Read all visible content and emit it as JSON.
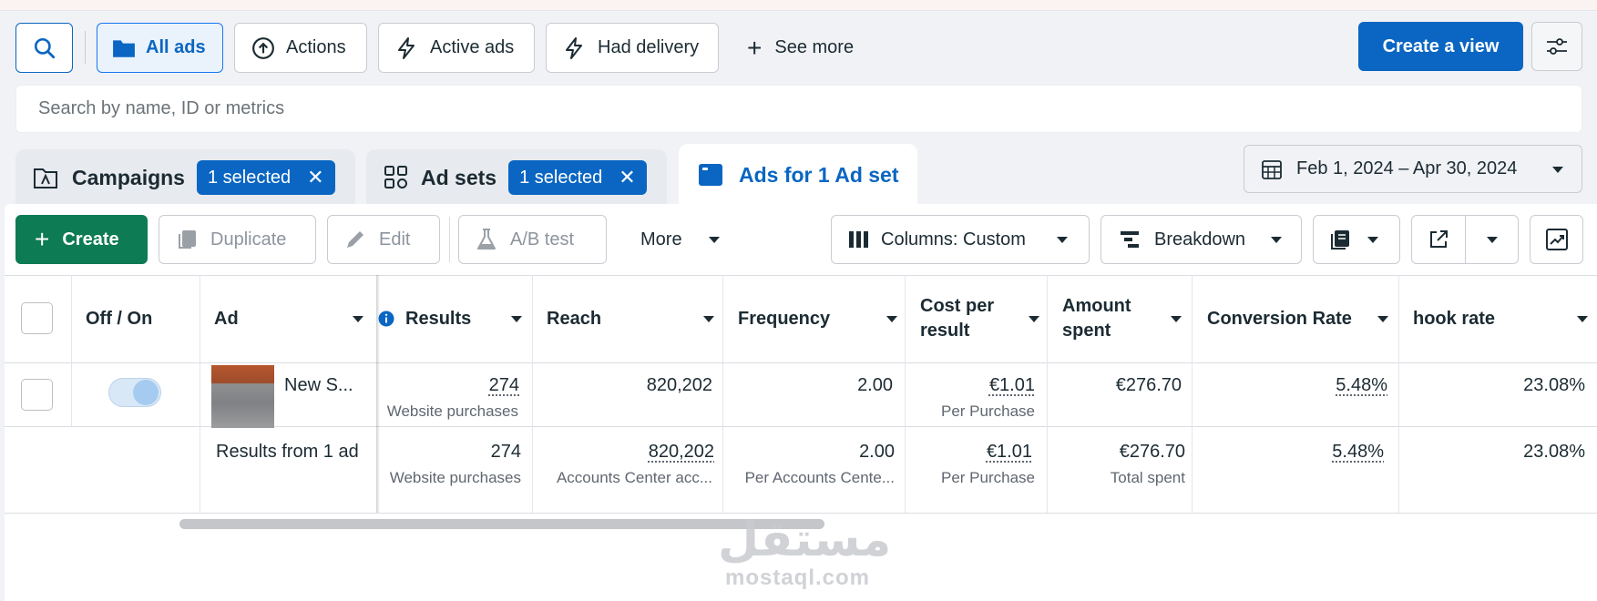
{
  "filters": {
    "all_ads": "All ads",
    "actions": "Actions",
    "active_ads": "Active ads",
    "had_delivery": "Had delivery",
    "see_more": "See more",
    "create_view": "Create a view"
  },
  "search": {
    "placeholder": "Search by name, ID or metrics"
  },
  "levels": {
    "campaigns": {
      "title": "Campaigns",
      "chip": "1 selected"
    },
    "adsets": {
      "title": "Ad sets",
      "chip": "1 selected"
    },
    "ads": {
      "title": "Ads for 1 Ad set"
    }
  },
  "date_range": "Feb 1, 2024 – Apr 30, 2024",
  "toolbar": {
    "create": "Create",
    "duplicate": "Duplicate",
    "edit": "Edit",
    "ab_test": "A/B test",
    "more": "More",
    "columns": "Columns: Custom",
    "breakdown": "Breakdown"
  },
  "table": {
    "headers": {
      "toggle": "Off / On",
      "ad": "Ad",
      "results": "Results",
      "reach": "Reach",
      "frequency": "Frequency",
      "cpr_1": "Cost per",
      "cpr_2": "result",
      "amount_1": "Amount",
      "amount_2": "spent",
      "conversion": "Conversion Rate",
      "hook": "hook rate"
    },
    "row": {
      "name": "New S...",
      "results": "274",
      "results_sub": "Website purchases",
      "reach": "820,202",
      "frequency": "2.00",
      "cpr": "€1.01",
      "cpr_sub": "Per Purchase",
      "amount": "€276.70",
      "conversion": "5.48%",
      "hook": "23.08%"
    },
    "summary": {
      "label": "Results from 1 ad",
      "results": "274",
      "results_sub": "Website purchases",
      "reach": "820,202",
      "reach_sub": "Accounts Center acc...",
      "frequency": "2.00",
      "frequency_sub": "Per Accounts Cente...",
      "cpr": "€1.01",
      "cpr_sub": "Per Purchase",
      "amount": "€276.70",
      "amount_sub": "Total spent",
      "conversion": "5.48%",
      "hook": "23.08%"
    }
  },
  "watermark": {
    "arabic": "مستقل",
    "latin": "mostaql.com"
  },
  "colors": {
    "accent": "#0a66c2",
    "create_green": "#0d7b53"
  }
}
